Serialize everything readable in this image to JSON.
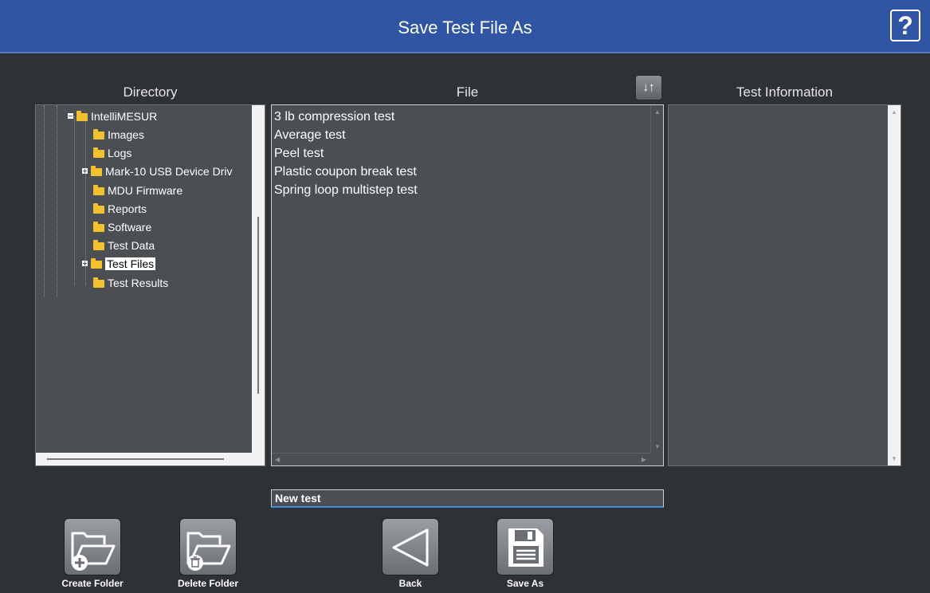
{
  "header": {
    "title": "Save Test File As",
    "help_label": "?"
  },
  "columns": {
    "directory": "Directory",
    "file": "File",
    "test_information": "Test Information"
  },
  "sort_button": {
    "icon": "sort-arrows-icon",
    "label": "↓↑"
  },
  "directory_tree": [
    {
      "label": "IntelliMESUR",
      "expander": "minus",
      "depth": 0
    },
    {
      "label": "Images",
      "expander": "none",
      "depth": 1
    },
    {
      "label": "Logs",
      "expander": "none",
      "depth": 1
    },
    {
      "label": "Mark-10 USB Device Driv",
      "expander": "plus",
      "depth": 1
    },
    {
      "label": "MDU Firmware",
      "expander": "none",
      "depth": 1
    },
    {
      "label": "Reports",
      "expander": "none",
      "depth": 1
    },
    {
      "label": "Software",
      "expander": "none",
      "depth": 1
    },
    {
      "label": "Test Data",
      "expander": "none",
      "depth": 1
    },
    {
      "label": "Test Files",
      "expander": "plus",
      "depth": 1,
      "selected": true
    },
    {
      "label": "Test Results",
      "expander": "none",
      "depth": 1
    }
  ],
  "files": [
    "3 lb compression test",
    "Average test",
    "Peel test",
    "Plastic coupon break test",
    "Spring loop multistep test"
  ],
  "filename_input": {
    "value": "New test"
  },
  "buttons": {
    "create_folder": "Create Folder",
    "delete_folder": "Delete Folder",
    "back": "Back",
    "save_as": "Save As"
  },
  "colors": {
    "title_bar": "#2f55a4",
    "background": "#2e3135",
    "panel": "#4b4f54",
    "folder": "#f2c12e"
  }
}
